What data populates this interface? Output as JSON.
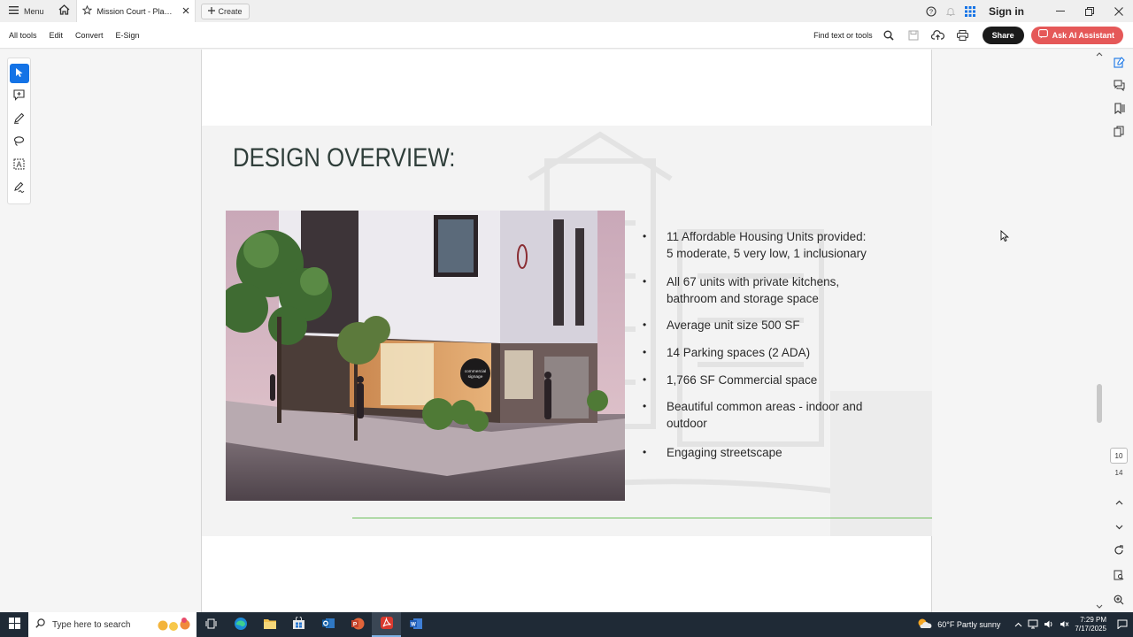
{
  "titlebar": {
    "menu_label": "Menu",
    "tab_title": "Mission Court - Planning...",
    "create_label": "Create",
    "signin_label": "Sign in"
  },
  "toolbar": {
    "items": [
      "All tools",
      "Edit",
      "Convert",
      "E-Sign"
    ],
    "find_label": "Find text or tools",
    "share_label": "Share",
    "ai_label": "Ask AI Assistant"
  },
  "slide": {
    "title": "DESIGN OVERVIEW:",
    "render_sign": "commercial signage",
    "bullets": [
      {
        "line1": "11 Affordable Housing Units provided:",
        "line2": "5 moderate, 5 very low, 1 inclusionary"
      },
      {
        "line1": "All 67 units with private kitchens,",
        "line2": "bathroom and storage space"
      },
      {
        "line1": "Average unit size 500 SF",
        "line2": ""
      },
      {
        "line1": "14 Parking spaces (2 ADA)",
        "line2": ""
      },
      {
        "line1": "1,766 SF Commercial space",
        "line2": ""
      },
      {
        "line1": "Beautiful common areas - indoor and",
        "line2": "outdoor"
      },
      {
        "line1": "Engaging streetscape",
        "line2": ""
      }
    ]
  },
  "rail": {
    "current_page": "10",
    "total_pages": "14"
  },
  "taskbar": {
    "search_placeholder": "Type here to search",
    "weather": "60°F  Partly sunny",
    "time": "7:29 PM",
    "date": "7/17/2025"
  },
  "colors": {
    "accent_blue": "#1473e6",
    "ai_button": "#e55858",
    "title_text": "#2f3e3a",
    "divider_green": "#6cbf5a"
  }
}
